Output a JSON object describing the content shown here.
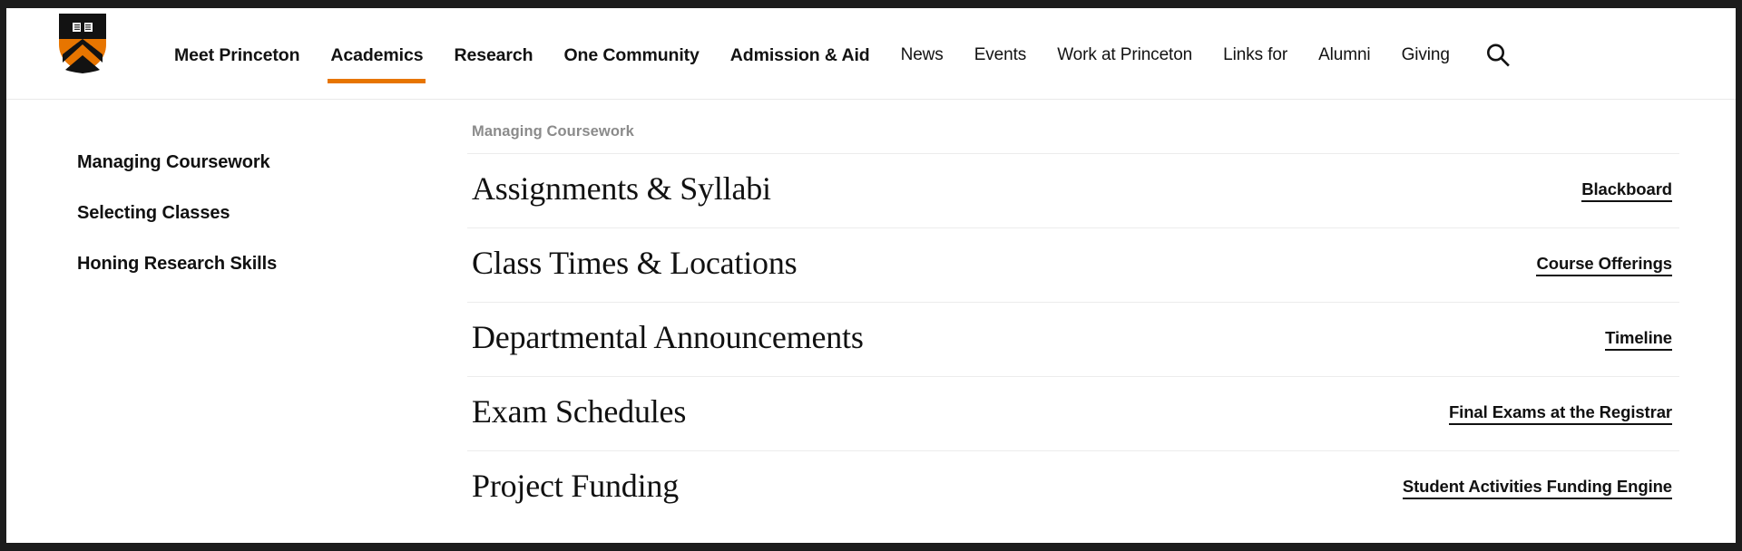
{
  "site": {
    "logo_name": "princeton-shield-logo"
  },
  "nav": {
    "primary_items": [
      {
        "label": "Meet Princeton",
        "name": "meet-princeton",
        "active": false
      },
      {
        "label": "Academics",
        "name": "academics",
        "active": true
      },
      {
        "label": "Research",
        "name": "research",
        "active": false
      },
      {
        "label": "One Community",
        "name": "one-community",
        "active": false
      },
      {
        "label": "Admission & Aid",
        "name": "admission-aid",
        "active": false
      }
    ],
    "secondary_items": [
      {
        "label": "News",
        "name": "news"
      },
      {
        "label": "Events",
        "name": "events"
      },
      {
        "label": "Work at Princeton",
        "name": "work-at-princeton"
      },
      {
        "label": "Links for",
        "name": "links-for"
      },
      {
        "label": "Alumni",
        "name": "alumni"
      },
      {
        "label": "Giving",
        "name": "giving"
      }
    ],
    "search_icon": "search-icon",
    "active_underline_color": "#E77500"
  },
  "sidebar": {
    "items": [
      {
        "label": "Managing Coursework",
        "name": "managing-coursework",
        "active": true
      },
      {
        "label": "Selecting Classes",
        "name": "selecting-classes",
        "active": false
      },
      {
        "label": "Honing Research Skills",
        "name": "honing-research-skills",
        "active": false
      }
    ],
    "active_indicator_color": "#C8801B"
  },
  "main": {
    "section_label": "Managing Coursework",
    "rows": [
      {
        "title": "Assignments & Syllabi",
        "link": "Blackboard"
      },
      {
        "title": "Class Times & Locations",
        "link": "Course Offerings"
      },
      {
        "title": "Departmental Announcements",
        "link": "Timeline"
      },
      {
        "title": "Exam Schedules",
        "link": "Final Exams at the Registrar"
      },
      {
        "title": "Project Funding",
        "link": "Student Activities Funding Engine"
      }
    ]
  }
}
